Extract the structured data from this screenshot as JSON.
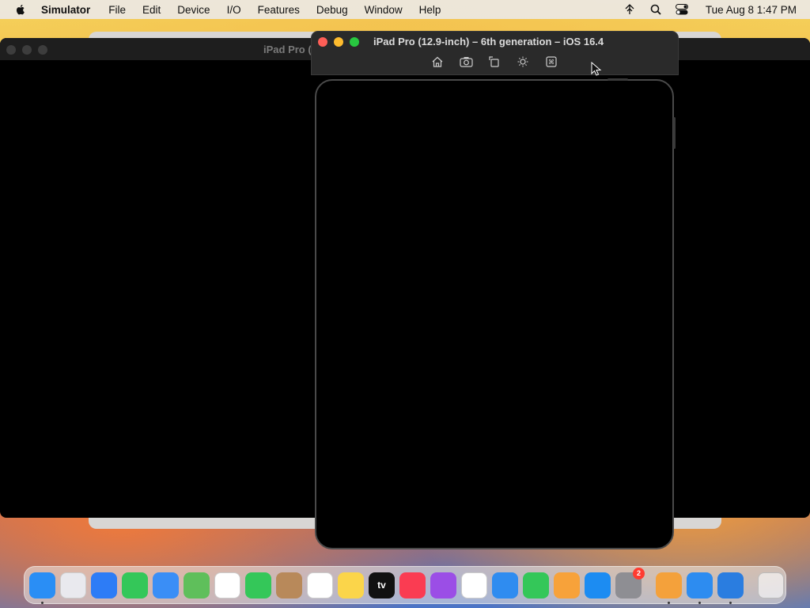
{
  "menubar": {
    "app_name": "Simulator",
    "items": [
      "File",
      "Edit",
      "Device",
      "I/O",
      "Features",
      "Debug",
      "Window",
      "Help"
    ],
    "clock": "Tue Aug 8  1:47 PM"
  },
  "back_window": {
    "title": "iPad Pro ("
  },
  "simulator_window": {
    "title": "iPad Pro (12.9-inch) – 6th generation – iOS 16.4",
    "toolbar": [
      "home-icon",
      "screenshot-icon",
      "rotate-icon",
      "appearance-icon",
      "keyboard-icon"
    ]
  },
  "dock": {
    "apps": [
      {
        "name": "finder",
        "color": "#2a8ef5",
        "running": true
      },
      {
        "name": "launchpad",
        "color": "#e9e9ee"
      },
      {
        "name": "safari",
        "color": "#2d7cf6"
      },
      {
        "name": "messages",
        "color": "#34c759"
      },
      {
        "name": "mail",
        "color": "#3a8ef6"
      },
      {
        "name": "maps",
        "color": "#5fbf5b"
      },
      {
        "name": "photos",
        "color": "#ffffff"
      },
      {
        "name": "facetime",
        "color": "#34c759"
      },
      {
        "name": "contacts",
        "color": "#b8895a"
      },
      {
        "name": "reminders",
        "color": "#ffffff"
      },
      {
        "name": "notes",
        "color": "#fbd54a"
      },
      {
        "name": "tv",
        "color": "#111111",
        "label": "tv"
      },
      {
        "name": "music",
        "color": "#fa3c52"
      },
      {
        "name": "podcasts",
        "color": "#9b4ee6"
      },
      {
        "name": "news",
        "color": "#ffffff"
      },
      {
        "name": "keynote",
        "color": "#2f8cf0"
      },
      {
        "name": "numbers",
        "color": "#34c759"
      },
      {
        "name": "pages",
        "color": "#f7a23a"
      },
      {
        "name": "app-store",
        "color": "#1c8cf2"
      },
      {
        "name": "system-settings",
        "color": "#8e8e93",
        "badge": "2"
      }
    ],
    "recent": [
      {
        "name": "simulator",
        "color": "#f4a13b",
        "running": true
      },
      {
        "name": "xcode",
        "color": "#2d8cf0",
        "running": true
      },
      {
        "name": "xcode-tools",
        "color": "#2a7de0",
        "running": true
      }
    ]
  }
}
